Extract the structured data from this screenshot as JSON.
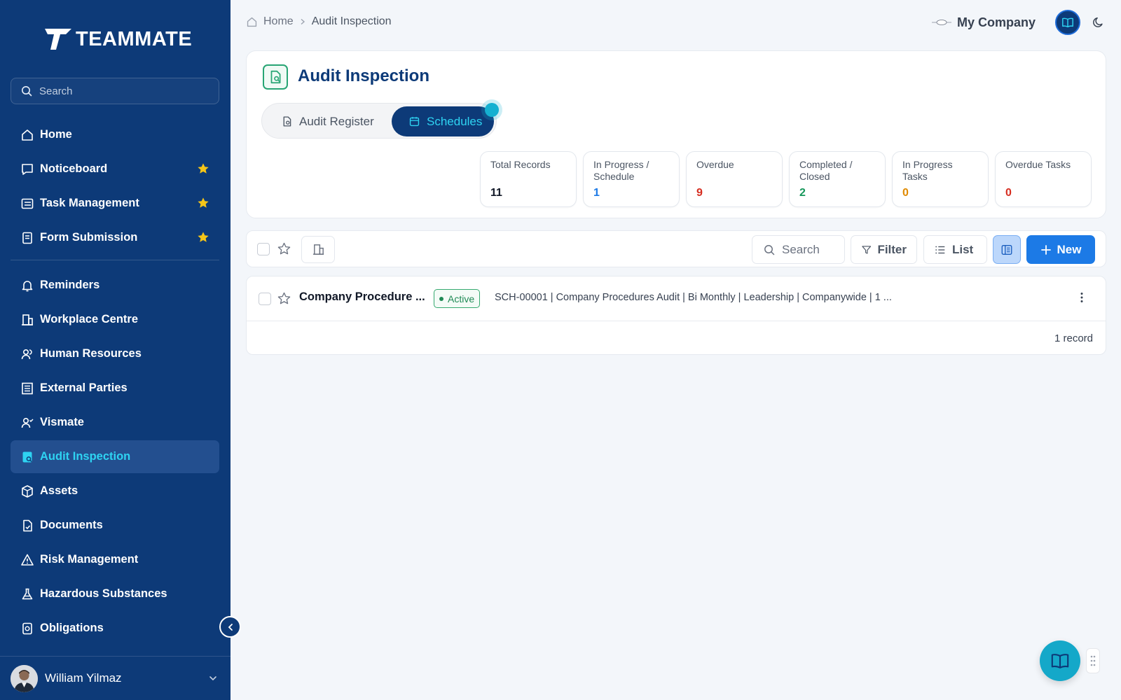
{
  "app": {
    "logo_text": "TEAMMATE"
  },
  "sidebar": {
    "search_placeholder": "Search",
    "items": [
      {
        "label": "Home",
        "icon": "home-icon",
        "starred": false
      },
      {
        "label": "Noticeboard",
        "icon": "message-icon",
        "starred": true
      },
      {
        "label": "Task Management",
        "icon": "task-list-icon",
        "starred": true
      },
      {
        "label": "Form Submission",
        "icon": "form-icon",
        "starred": true
      },
      {
        "label": "Reminders",
        "icon": "bell-icon",
        "starred": false
      },
      {
        "label": "Workplace Centre",
        "icon": "building-icon",
        "starred": false
      },
      {
        "label": "Human Resources",
        "icon": "users-icon",
        "starred": false
      },
      {
        "label": "External Parties",
        "icon": "building-list-icon",
        "starred": false
      },
      {
        "label": "Vismate",
        "icon": "user-check-icon",
        "starred": false
      },
      {
        "label": "Audit Inspection",
        "icon": "audit-icon",
        "starred": false,
        "active": true
      },
      {
        "label": "Assets",
        "icon": "box-icon",
        "starred": false
      },
      {
        "label": "Documents",
        "icon": "document-icon",
        "starred": false
      },
      {
        "label": "Risk Management",
        "icon": "warning-icon",
        "starred": false
      },
      {
        "label": "Hazardous Substances",
        "icon": "flask-icon",
        "starred": false
      },
      {
        "label": "Obligations",
        "icon": "obligation-icon",
        "starred": false
      }
    ],
    "user": {
      "name": "William Yilmaz"
    }
  },
  "header": {
    "breadcrumb": {
      "home": "Home",
      "current": "Audit Inspection"
    },
    "company_name": "My Company"
  },
  "page": {
    "title": "Audit Inspection",
    "tabs": [
      {
        "label": "Audit Register"
      },
      {
        "label": "Schedules",
        "active": true
      }
    ],
    "stats": [
      {
        "label": "Total Records",
        "value": "11",
        "color": "#111827"
      },
      {
        "label": "In Progress / Schedule",
        "value": "1",
        "color": "#1c7ae6"
      },
      {
        "label": "Overdue",
        "value": "9",
        "color": "#d62d20"
      },
      {
        "label": "Completed / Closed",
        "value": "2",
        "color": "#15965a"
      },
      {
        "label": "In Progress Tasks",
        "value": "0",
        "color": "#e08a00"
      },
      {
        "label": "Overdue Tasks",
        "value": "0",
        "color": "#d62d20"
      }
    ]
  },
  "toolbar": {
    "search_placeholder": "Search",
    "filter_label": "Filter",
    "list_label": "List",
    "new_label": "New"
  },
  "records": [
    {
      "title": "Company Procedure ...",
      "status": "Active",
      "description": "SCH-00001 | Company Procedures Audit | Bi Monthly | Leadership | Companywide | 1 ..."
    }
  ],
  "record_count": "1 record",
  "colors": {
    "sidebar_bg": "#0d3a78",
    "accent_cyan": "#2ed3f2",
    "primary_blue": "#1c7ae6",
    "active_green": "#1f8a55"
  }
}
